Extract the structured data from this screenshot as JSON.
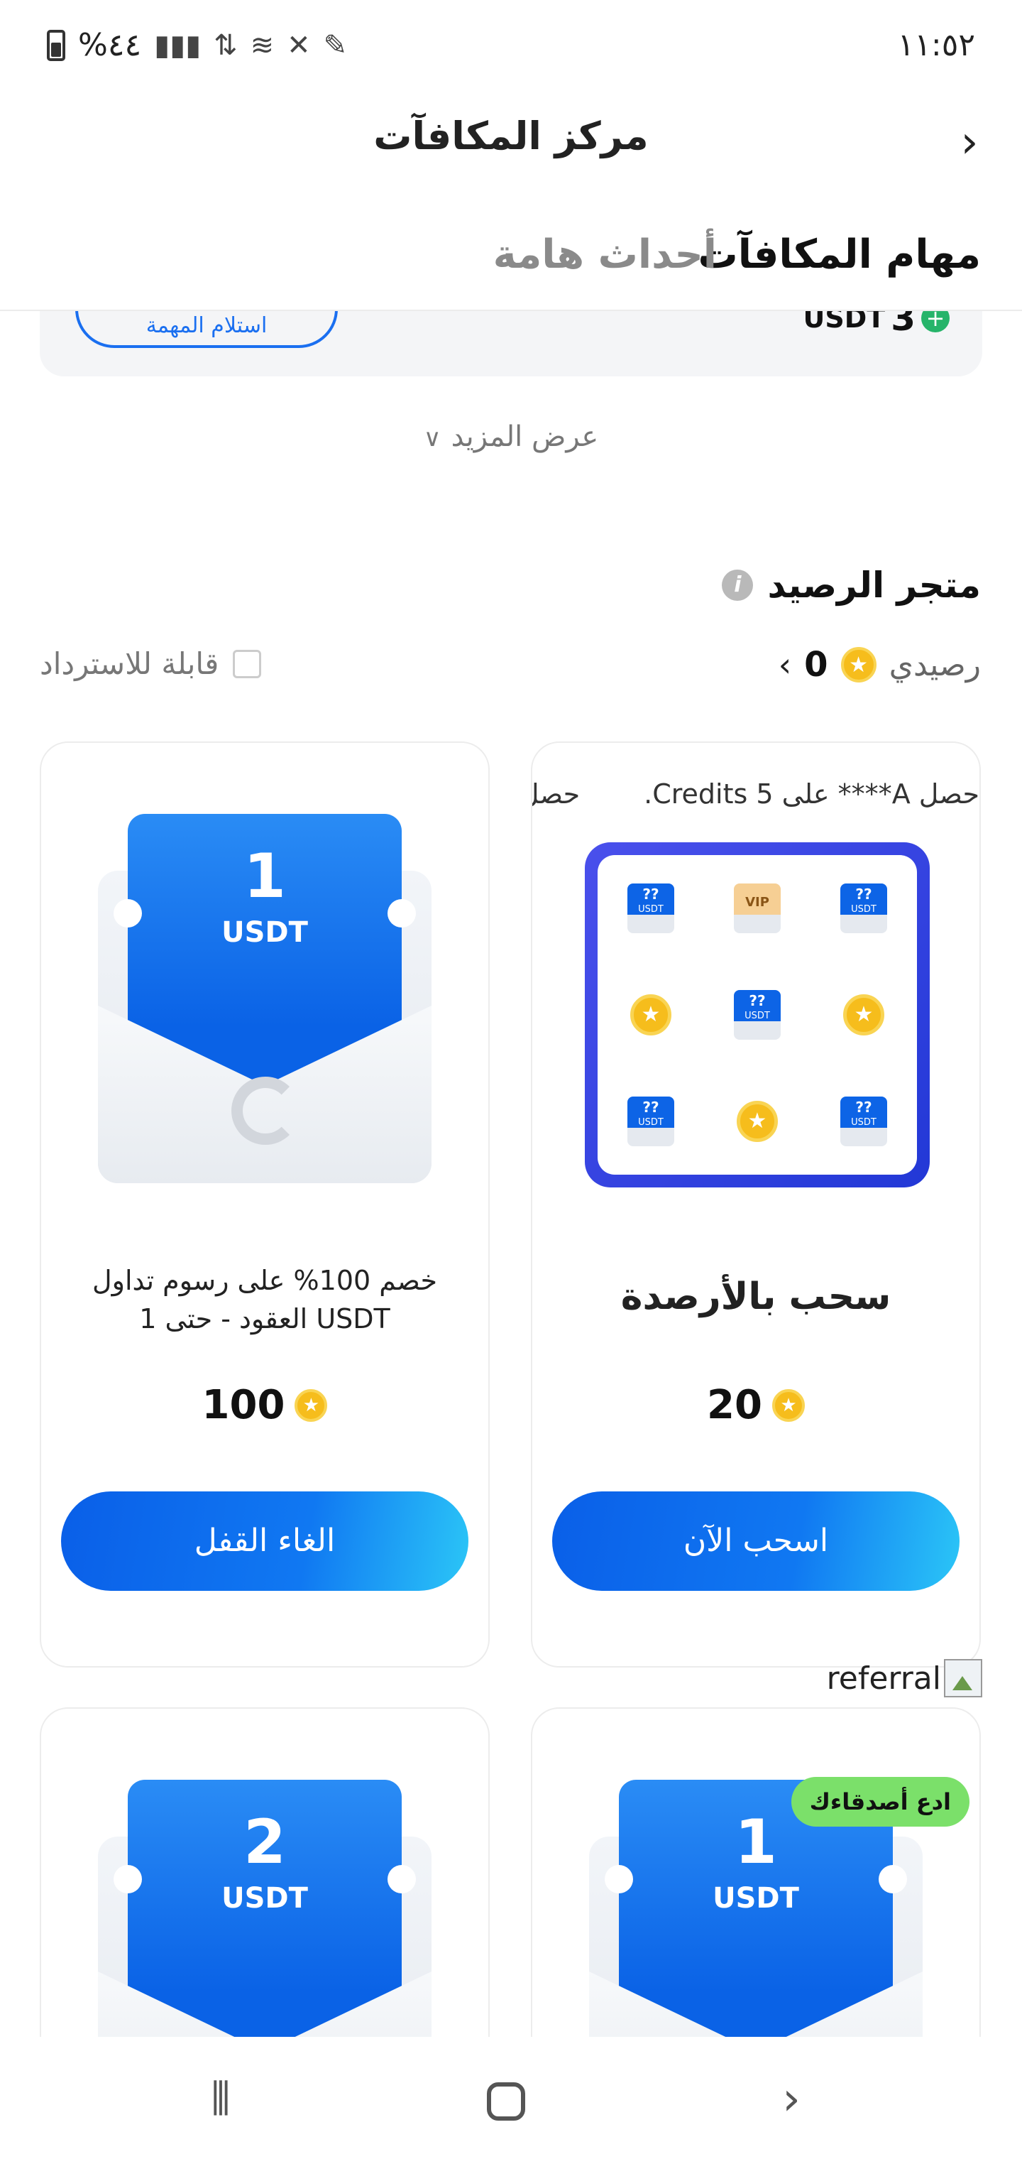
{
  "status_bar": {
    "time": "١١:٥٢",
    "battery_text": "%٤٤",
    "icons": [
      "battery-icon",
      "signal-icon",
      "data-icon",
      "wifi-icon",
      "mute-icon",
      "edit-icon"
    ]
  },
  "header": {
    "title": "مركز المكافآت",
    "back_icon": "chevron-right-icon"
  },
  "tabs": [
    {
      "label": "مهام المكافآت",
      "active": true
    },
    {
      "label": "أحداث هامة",
      "active": false
    }
  ],
  "task_card": {
    "button_label": "استلام المهمة",
    "reward_value": "3",
    "reward_currency": "USDT"
  },
  "show_more": {
    "label": "عرض المزيد"
  },
  "store": {
    "title": "متجر الرصيد",
    "balance_label": "رصيدي",
    "balance_value": "0",
    "redeemable_label": "قابلة للاسترداد",
    "redeemable_checked": false
  },
  "products": [
    {
      "amount": "1",
      "currency": "USDT",
      "description": "خصم 100% على رسوم تداول العقود - حتى 1 USDT",
      "price": "100",
      "button_label": "الغاء القفل"
    },
    {
      "ticker": [
        "حصل A**** على 5 Credits.",
        "حصل A"
      ],
      "name": "سحب بالأرصدة",
      "price": "20",
      "button_label": "اسحب الآن",
      "grid_items": [
        "??",
        "VIP",
        "??",
        "star",
        "??",
        "star",
        "??",
        "star",
        "??"
      ],
      "grid_item_sub": "USDT"
    },
    {
      "amount": "2",
      "currency": "USDT"
    },
    {
      "amount": "1",
      "currency": "USDT",
      "badge": "ادع أصدقاءك"
    }
  ],
  "referral": {
    "alt_text": "referral"
  },
  "nav_bar": {
    "recent_icon": "recent-apps-icon",
    "home_icon": "home-icon",
    "back_icon": "back-icon"
  },
  "colors": {
    "primary_blue": "#0a62e6",
    "accent_cyan": "#2bc6f7",
    "coin_gold": "#f6bd1c",
    "badge_green": "#7be06a",
    "success_green": "#26b46a"
  }
}
